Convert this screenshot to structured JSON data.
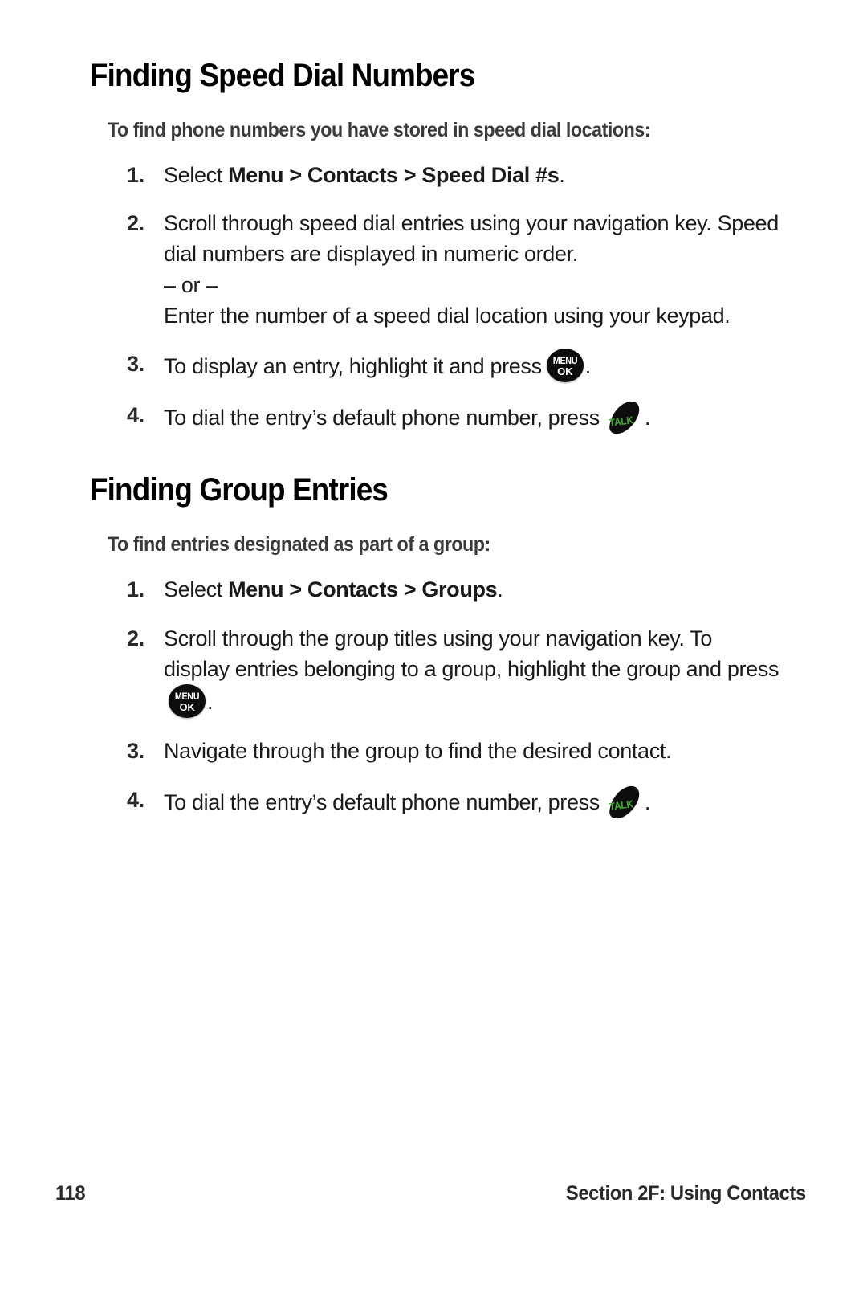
{
  "page": {
    "number": "118",
    "section_footer": "Section 2F: Using Contacts"
  },
  "icons": {
    "menu_ok": {
      "line1": "MENU",
      "line2": "OK",
      "name": "menu-ok-key-icon",
      "color": "#0d0d0d"
    },
    "talk": {
      "label": "TALK",
      "name": "talk-key-icon",
      "body_color": "#0d0d0d",
      "text_color": "#3faa2e"
    }
  },
  "sections": [
    {
      "title": "Finding Speed Dial Numbers",
      "intro": "To find phone numbers you have stored in speed dial locations:",
      "steps": [
        {
          "num": "1.",
          "pre": "Select ",
          "bold1": "Menu",
          "sep1": " > ",
          "bold2": "Contacts",
          "sep2": " > ",
          "bold3": "Speed Dial #s",
          "post": "."
        },
        {
          "num": "2.",
          "line1": "Scroll through speed dial entries using your navigation key. Speed dial numbers are displayed in numeric order.",
          "or": "– or –",
          "line2": "Enter the number of a speed dial location using your keypad."
        },
        {
          "num": "3.",
          "pre": "To display an entry, highlight it and press",
          "post": "."
        },
        {
          "num": "4.",
          "pre": "To dial the entry’s default phone number, press",
          "post": "."
        }
      ]
    },
    {
      "title": "Finding Group Entries",
      "intro": "To find entries designated as part of a group:",
      "steps": [
        {
          "num": "1.",
          "pre": "Select ",
          "bold1": "Menu",
          "sep1": " > ",
          "bold2": "Contacts",
          "sep2": " > ",
          "bold3": "Groups",
          "post": "."
        },
        {
          "num": "2.",
          "pre": "Scroll through the group titles using your navigation key. To display entries belonging to a group, highlight the group and press",
          "post": "."
        },
        {
          "num": "3.",
          "pre": "Navigate through the group to find the desired contact."
        },
        {
          "num": "4.",
          "pre": "To dial the entry’s default phone number, press",
          "post": "."
        }
      ]
    }
  ]
}
